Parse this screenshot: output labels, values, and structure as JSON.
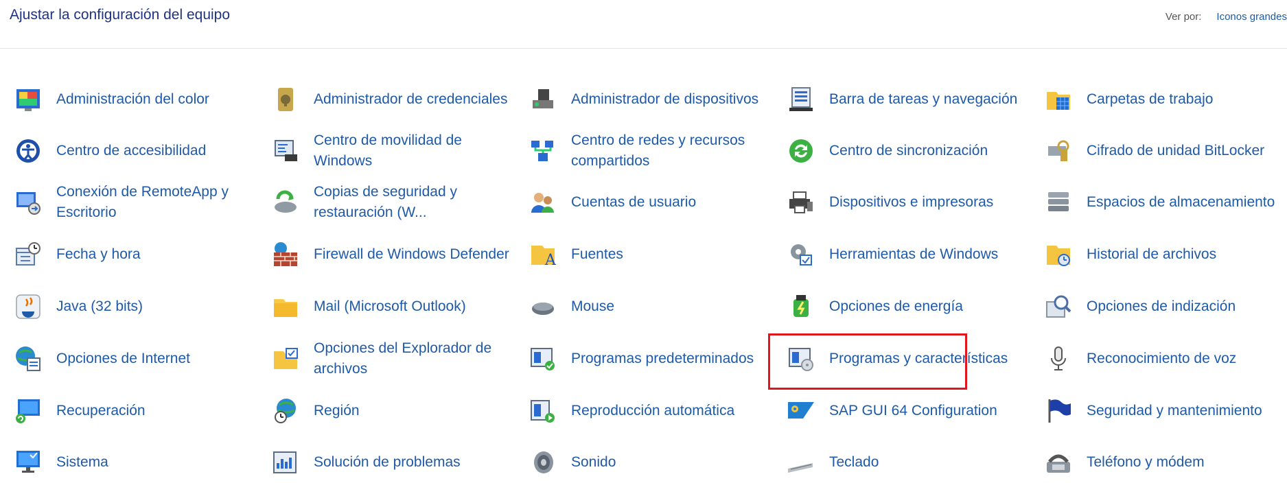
{
  "header": {
    "title": "Ajustar la configuración del equipo",
    "view_by_label": "Ver por:",
    "view_by_value": "Iconos grandes"
  },
  "items": [
    {
      "label": "Administración del color",
      "icon": "color-management-icon"
    },
    {
      "label": "Administrador de credenciales",
      "icon": "credential-manager-icon"
    },
    {
      "label": "Administrador de dispositivos",
      "icon": "device-manager-icon"
    },
    {
      "label": "Barra de tareas y navegación",
      "icon": "taskbar-icon"
    },
    {
      "label": "Carpetas de trabajo",
      "icon": "work-folders-icon"
    },
    {
      "label": "Centro de accesibilidad",
      "icon": "accessibility-icon"
    },
    {
      "label": "Centro de movilidad de Windows",
      "icon": "mobility-center-icon"
    },
    {
      "label": "Centro de redes y recursos compartidos",
      "icon": "network-center-icon"
    },
    {
      "label": "Centro de sincronización",
      "icon": "sync-center-icon"
    },
    {
      "label": "Cifrado de unidad BitLocker",
      "icon": "bitlocker-icon"
    },
    {
      "label": "Conexión de RemoteApp y Escritorio",
      "icon": "remoteapp-icon"
    },
    {
      "label": "Copias de seguridad y restauración (W...",
      "icon": "backup-icon"
    },
    {
      "label": "Cuentas de usuario",
      "icon": "user-accounts-icon"
    },
    {
      "label": "Dispositivos e impresoras",
      "icon": "printer-icon"
    },
    {
      "label": "Espacios de almacenamiento",
      "icon": "storage-spaces-icon"
    },
    {
      "label": "Fecha y hora",
      "icon": "calendar-clock-icon"
    },
    {
      "label": "Firewall de Windows Defender",
      "icon": "firewall-icon"
    },
    {
      "label": "Fuentes",
      "icon": "fonts-icon"
    },
    {
      "label": "Herramientas de Windows",
      "icon": "gear-tools-icon"
    },
    {
      "label": "Historial de archivos",
      "icon": "file-history-icon"
    },
    {
      "label": "Java (32 bits)",
      "icon": "java-icon"
    },
    {
      "label": "Mail (Microsoft Outlook)",
      "icon": "mail-folder-icon"
    },
    {
      "label": "Mouse",
      "icon": "mouse-icon"
    },
    {
      "label": "Opciones de energía",
      "icon": "power-icon"
    },
    {
      "label": "Opciones de indización",
      "icon": "indexing-icon"
    },
    {
      "label": "Opciones de Internet",
      "icon": "internet-options-icon"
    },
    {
      "label": "Opciones del Explorador de archivos",
      "icon": "explorer-options-icon"
    },
    {
      "label": "Programas predeterminados",
      "icon": "default-programs-icon"
    },
    {
      "label": "Programas y características",
      "icon": "programs-features-icon"
    },
    {
      "label": "Reconocimiento de voz",
      "icon": "microphone-icon"
    },
    {
      "label": "Recuperación",
      "icon": "recovery-icon"
    },
    {
      "label": "Región",
      "icon": "region-globe-icon"
    },
    {
      "label": "Reproducción automática",
      "icon": "autoplay-icon"
    },
    {
      "label": "SAP GUI 64 Configuration",
      "icon": "sap-icon"
    },
    {
      "label": "Seguridad y mantenimiento",
      "icon": "security-flag-icon"
    },
    {
      "label": "Sistema",
      "icon": "system-monitor-icon"
    },
    {
      "label": "Solución de problemas",
      "icon": "troubleshoot-icon"
    },
    {
      "label": "Sonido",
      "icon": "speaker-icon"
    },
    {
      "label": "Teclado",
      "icon": "keyboard-icon"
    },
    {
      "label": "Teléfono y módem",
      "icon": "phone-modem-icon"
    }
  ],
  "colors": {
    "link": "#1e5aa8",
    "title": "#1e3287",
    "highlight": "#e0161c"
  }
}
